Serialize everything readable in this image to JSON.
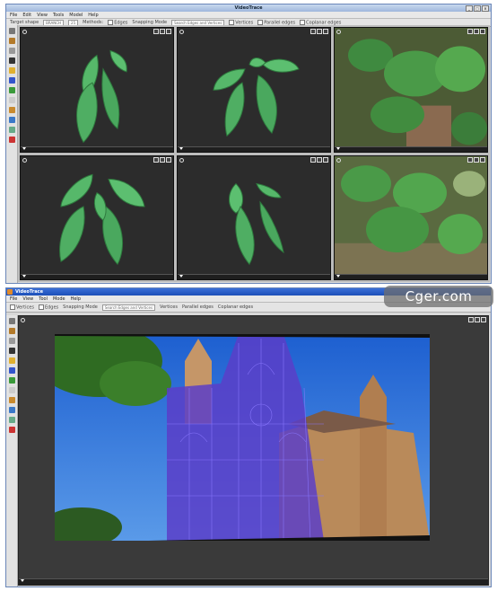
{
  "app": {
    "title": "VideoTrace",
    "menu": [
      "File",
      "Edit",
      "View",
      "Tools",
      "Model",
      "Help"
    ]
  },
  "options_top": {
    "target_shape_label": "Target shape",
    "target_shape_value": "BRANCH",
    "count_value": "25",
    "methods_label": "Methods:",
    "edges_label": "Edges",
    "snapping_label": "Snapping Mode",
    "snapping_value": "Search Edges and Vertices",
    "vertices_label": "Vertices",
    "parallel_label": "Parallel edges",
    "coplanar_label": "Coplanar edges"
  },
  "window2": {
    "title": "VideoTrace",
    "menu": [
      "File",
      "View",
      "Tool",
      "Mode",
      "Help"
    ],
    "options": {
      "vertices_label": "Vertices",
      "edges_label": "Edges",
      "snapping_label": "Snapping Mode",
      "snapping_value": "Search Edges and Vertices",
      "vertices2_label": "Vertices",
      "parallel_label": "Parallel edges",
      "coplanar_label": "Coplanar edges"
    }
  },
  "watermark": "Cger.com",
  "colors": {
    "leaf": "#4fae63",
    "model_overlay": "#5a3ec8",
    "sky": "#2f6ed8"
  }
}
